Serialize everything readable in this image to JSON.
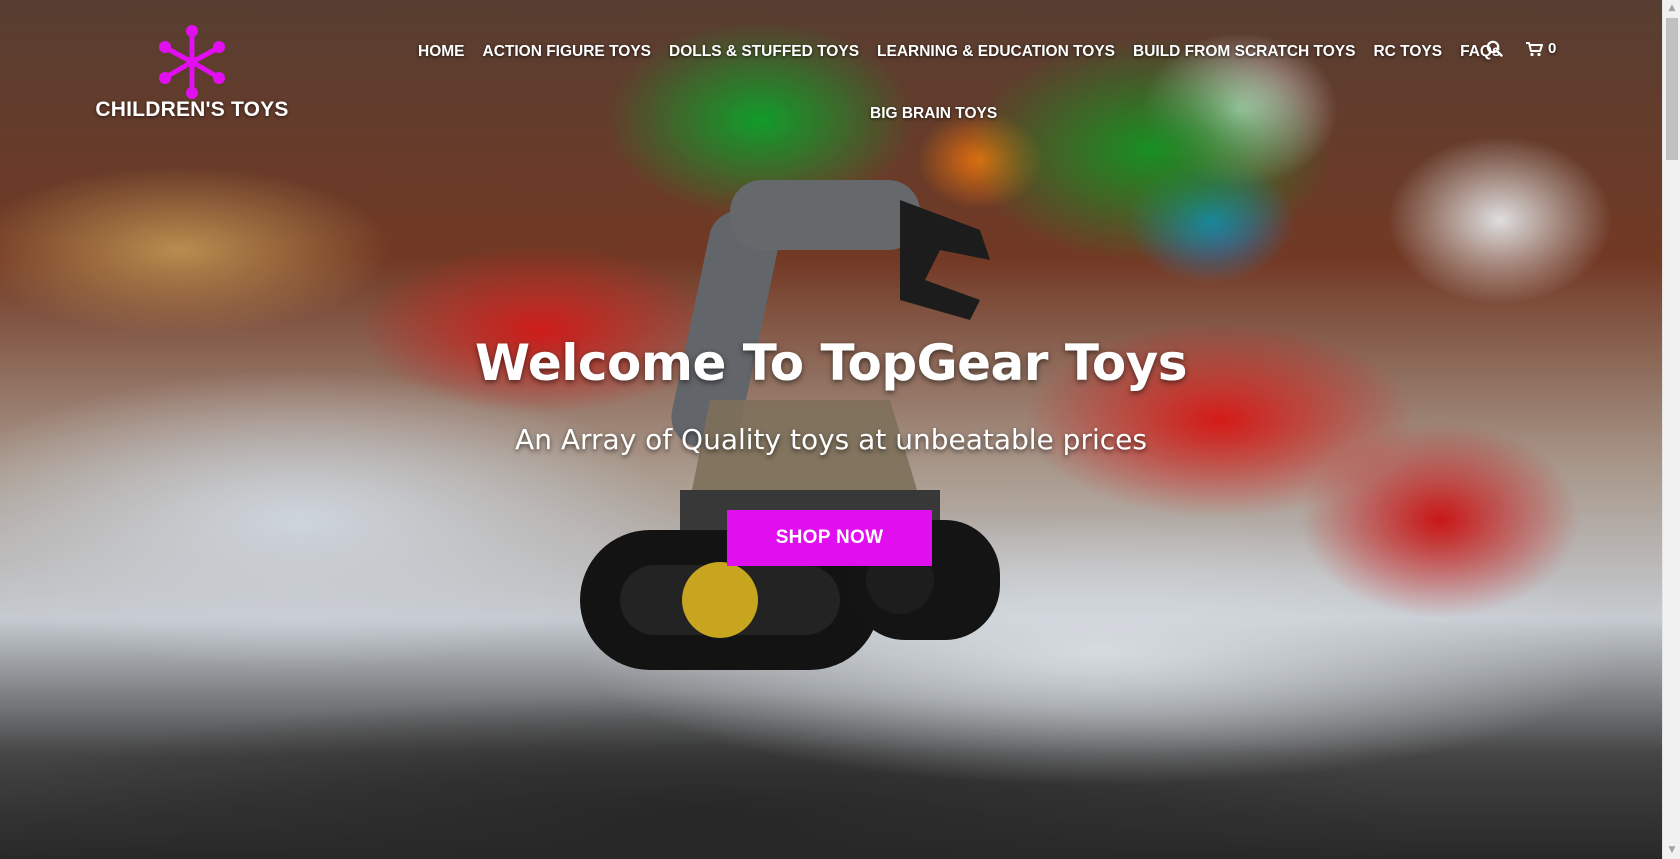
{
  "brand": {
    "logo_text": "CHILDREN'S TOYS",
    "logo_color": "#e10ef0"
  },
  "nav": {
    "items": [
      {
        "label": "HOME"
      },
      {
        "label": "ACTION FIGURE TOYS"
      },
      {
        "label": "DOLLS & STUFFED TOYS"
      },
      {
        "label": "LEARNING & EDUCATION TOYS"
      },
      {
        "label": "BUILD FROM SCRATCH TOYS"
      },
      {
        "label": "RC TOYS"
      },
      {
        "label": "FAQs"
      },
      {
        "label": "BIG BRAIN TOYS"
      }
    ]
  },
  "header_icons": {
    "search_icon": "search-icon",
    "cart_icon": "cart-icon",
    "cart_count": "0"
  },
  "hero": {
    "title": "Welcome To TopGear Toys",
    "subtitle": "An Array of Quality toys at unbeatable prices",
    "cta_label": "SHOP NOW",
    "cta_color": "#e10ef0"
  }
}
